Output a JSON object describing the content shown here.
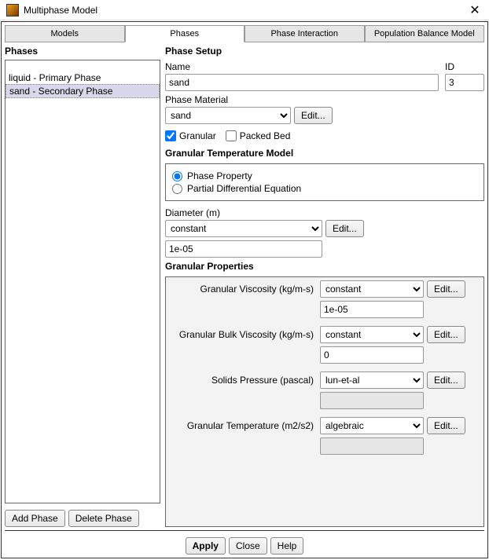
{
  "title": "Multiphase Model",
  "tabs": {
    "models": "Models",
    "phases": "Phases",
    "interaction": "Phase Interaction",
    "pbm": "Population Balance Model"
  },
  "left": {
    "heading": "Phases",
    "items": [
      "liquid - Primary Phase",
      "sand - Secondary Phase"
    ],
    "add": "Add Phase",
    "del": "Delete Phase"
  },
  "setup": {
    "heading": "Phase Setup",
    "name_lbl": "Name",
    "name_val": "sand",
    "id_lbl": "ID",
    "id_val": "3",
    "mat_lbl": "Phase Material",
    "mat_val": "sand",
    "edit": "Edit...",
    "granular_lbl": "Granular",
    "packed_lbl": "Packed Bed",
    "gtm_heading": "Granular Temperature Model",
    "gtm_opt1": "Phase Property",
    "gtm_opt2": "Partial Differential Equation",
    "diam_lbl": "Diameter (m)",
    "diam_sel": "constant",
    "diam_val": "1e-05",
    "gp_heading": "Granular Properties",
    "props": {
      "viscosity_lbl": "Granular Viscosity (kg/m-s)",
      "viscosity_sel": "constant",
      "viscosity_val": "1e-05",
      "bulk_lbl": "Granular Bulk Viscosity (kg/m-s)",
      "bulk_sel": "constant",
      "bulk_val": "0",
      "press_lbl": "Solids Pressure (pascal)",
      "press_sel": "lun-et-al",
      "press_val": "",
      "temp_lbl": "Granular Temperature (m2/s2)",
      "temp_sel": "algebraic",
      "temp_val": ""
    }
  },
  "bottom": {
    "apply": "Apply",
    "close": "Close",
    "help": "Help"
  }
}
